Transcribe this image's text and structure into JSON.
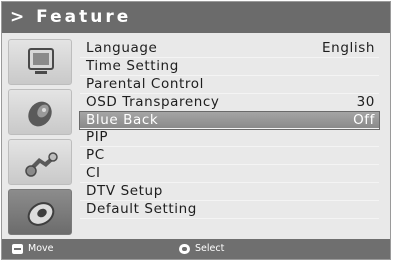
{
  "title": "> Feature",
  "icons": [
    {
      "name": "picture-icon"
    },
    {
      "name": "sound-icon"
    },
    {
      "name": "channel-icon"
    },
    {
      "name": "feature-icon",
      "selected": true
    }
  ],
  "menu": {
    "items": [
      {
        "label": "Language",
        "value": "English"
      },
      {
        "label": "Time Setting",
        "value": ""
      },
      {
        "label": "Parental Control",
        "value": ""
      },
      {
        "label": "OSD Transparency",
        "value": "30"
      },
      {
        "label": "Blue Back",
        "value": "Off",
        "selected": true
      },
      {
        "label": "PIP",
        "value": ""
      },
      {
        "label": "PC",
        "value": ""
      },
      {
        "label": "CI",
        "value": ""
      },
      {
        "label": "DTV Setup",
        "value": ""
      },
      {
        "label": "Default Setting",
        "value": ""
      }
    ]
  },
  "footer": {
    "move_label": "Move",
    "select_label": "Select"
  },
  "colors": {
    "title_bar": "#6b6b6b",
    "panel_bg": "#e9e9e9",
    "highlight": "#8f8f8f",
    "footer_bg": "#6f6f6f"
  }
}
